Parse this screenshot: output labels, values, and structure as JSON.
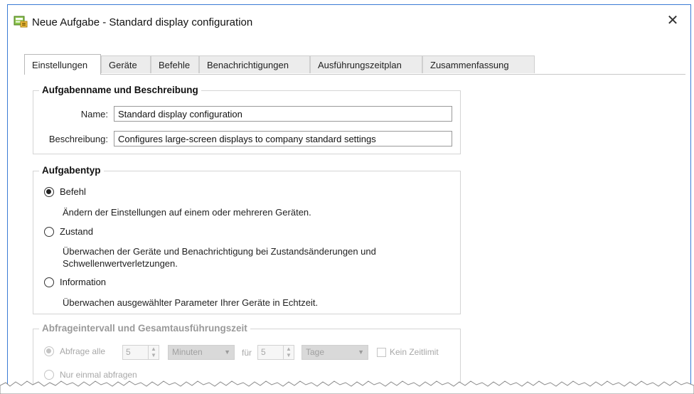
{
  "window": {
    "title": "Neue Aufgabe - Standard display configuration",
    "close_glyph": "✕"
  },
  "tabs": [
    {
      "label": "Einstellungen",
      "active": true
    },
    {
      "label": "Geräte"
    },
    {
      "label": "Befehle"
    },
    {
      "label": "Benachrichtigungen"
    },
    {
      "label": "Ausführungszeitplan"
    },
    {
      "label": "Zusammenfassung"
    }
  ],
  "task_info": {
    "title": "Aufgabenname und Beschreibung",
    "name_label": "Name:",
    "name_value": "Standard display configuration",
    "desc_label": "Beschreibung:",
    "desc_value": "Configures large-screen displays to company standard settings"
  },
  "task_type": {
    "title": "Aufgabentyp",
    "options": [
      {
        "label": "Befehl",
        "checked": true,
        "desc": "Ändern der Einstellungen auf einem oder mehreren Geräten."
      },
      {
        "label": "Zustand",
        "checked": false,
        "desc": "Überwachen der Geräte und Benachrichtigung bei Zustandsänderungen und Schwellenwertverletzungen."
      },
      {
        "label": "Information",
        "checked": false,
        "desc": "Überwachen ausgewählter Parameter Ihrer Geräte in Echtzeit."
      }
    ]
  },
  "polling": {
    "title": "Abfrageintervall und Gesamtausführungszeit",
    "poll_every_label": "Abfrage alle",
    "interval_value": "5",
    "interval_unit": "Minuten",
    "for_label": "für",
    "duration_value": "5",
    "duration_unit": "Tage",
    "no_limit_label": "Kein Zeitlimit",
    "once_label": "Nur einmal abfragen"
  },
  "colors": {
    "accent": "#3a7bd5",
    "border": "#d4d4d4",
    "disabled_text": "#a8a8a8"
  }
}
